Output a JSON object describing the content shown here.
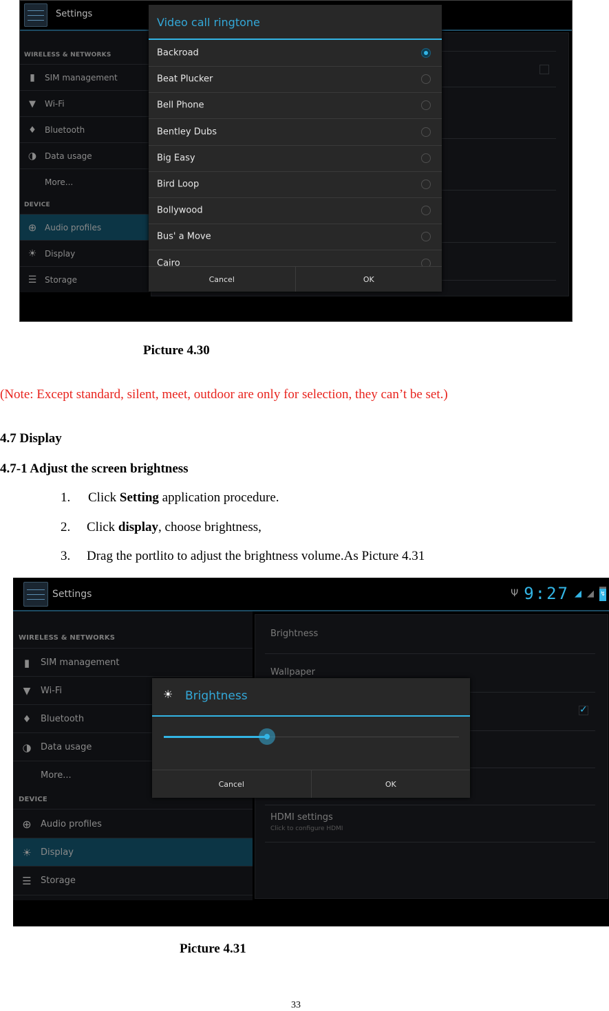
{
  "picture_430": {
    "app_title": "Settings",
    "sidebar": {
      "section_wireless": "WIRELESS & NETWORKS",
      "section_device": "DEVICE",
      "items": [
        {
          "icon": "sim-icon",
          "label": "SIM management"
        },
        {
          "icon": "wifi-icon",
          "label": "Wi-Fi"
        },
        {
          "icon": "bluetooth-icon",
          "label": "Bluetooth"
        },
        {
          "icon": "data-usage-icon",
          "label": "Data usage"
        },
        {
          "icon": "",
          "label": "More..."
        },
        {
          "icon": "audio-profiles-icon",
          "label": "Audio profiles",
          "selected": true
        },
        {
          "icon": "display-icon",
          "label": "Display"
        },
        {
          "icon": "storage-icon",
          "label": "Storage"
        }
      ]
    },
    "dialog": {
      "title": "Video call ringtone",
      "options": [
        {
          "label": "Backroad",
          "selected": true
        },
        {
          "label": "Beat Plucker",
          "selected": false
        },
        {
          "label": "Bell Phone",
          "selected": false
        },
        {
          "label": "Bentley Dubs",
          "selected": false
        },
        {
          "label": "Big Easy",
          "selected": false
        },
        {
          "label": "Bird Loop",
          "selected": false
        },
        {
          "label": "Bollywood",
          "selected": false
        },
        {
          "label": "Bus' a Move",
          "selected": false
        },
        {
          "label": "Cairo",
          "selected": false
        }
      ],
      "cancel_label": "Cancel",
      "ok_label": "OK"
    },
    "caption": "Picture 4.30"
  },
  "note": "(Note: Except standard, silent, meet, outdoor are only for selection, they can’t be set.)",
  "note_color": "#e8231d",
  "section_title": "4.7 Display",
  "subsection_title": "4.7-1 Adjust the screen brightness",
  "steps": [
    {
      "num": "1.",
      "pre": "Click ",
      "bold": "Setting",
      "post": " application procedure."
    },
    {
      "num": "2.",
      "pre": "Click ",
      "bold": "display",
      "post": ", choose brightness,"
    },
    {
      "num": "3.",
      "pre": "Drag the portlito to adjust the brightness volume.As Picture 4.31",
      "bold": "",
      "post": ""
    }
  ],
  "picture_431": {
    "app_title": "Settings",
    "status_bar": {
      "time": "9:27",
      "icons": [
        "usb-icon",
        "data-signal-icon",
        "signal-icon",
        "battery-charging-icon"
      ]
    },
    "sidebar": {
      "section_wireless": "WIRELESS & NETWORKS",
      "section_device": "DEVICE",
      "items": [
        {
          "icon": "sim-icon",
          "label": "SIM management"
        },
        {
          "icon": "wifi-icon",
          "label": "Wi-Fi"
        },
        {
          "icon": "bluetooth-icon",
          "label": "Bluetooth"
        },
        {
          "icon": "data-usage-icon",
          "label": "Data usage"
        },
        {
          "icon": "",
          "label": "More..."
        },
        {
          "icon": "audio-profiles-icon",
          "label": "Audio profiles"
        },
        {
          "icon": "display-icon",
          "label": "Display",
          "selected": true
        },
        {
          "icon": "storage-icon",
          "label": "Storage"
        }
      ]
    },
    "detail": {
      "brightness_label": "Brightness",
      "wallpaper_label": "Wallpaper",
      "auto_rotate_checked": true,
      "hdmi_title": "HDMI settings",
      "hdmi_summary": "Click to configure HDMI"
    },
    "dialog": {
      "title": "Brightness",
      "brightness_fraction": 0.35,
      "cancel_label": "Cancel",
      "ok_label": "OK"
    },
    "caption": "Picture 4.31"
  },
  "page_number": "33",
  "colors": {
    "accent": "#33b5e5",
    "selected_bg": "#0c3545"
  }
}
